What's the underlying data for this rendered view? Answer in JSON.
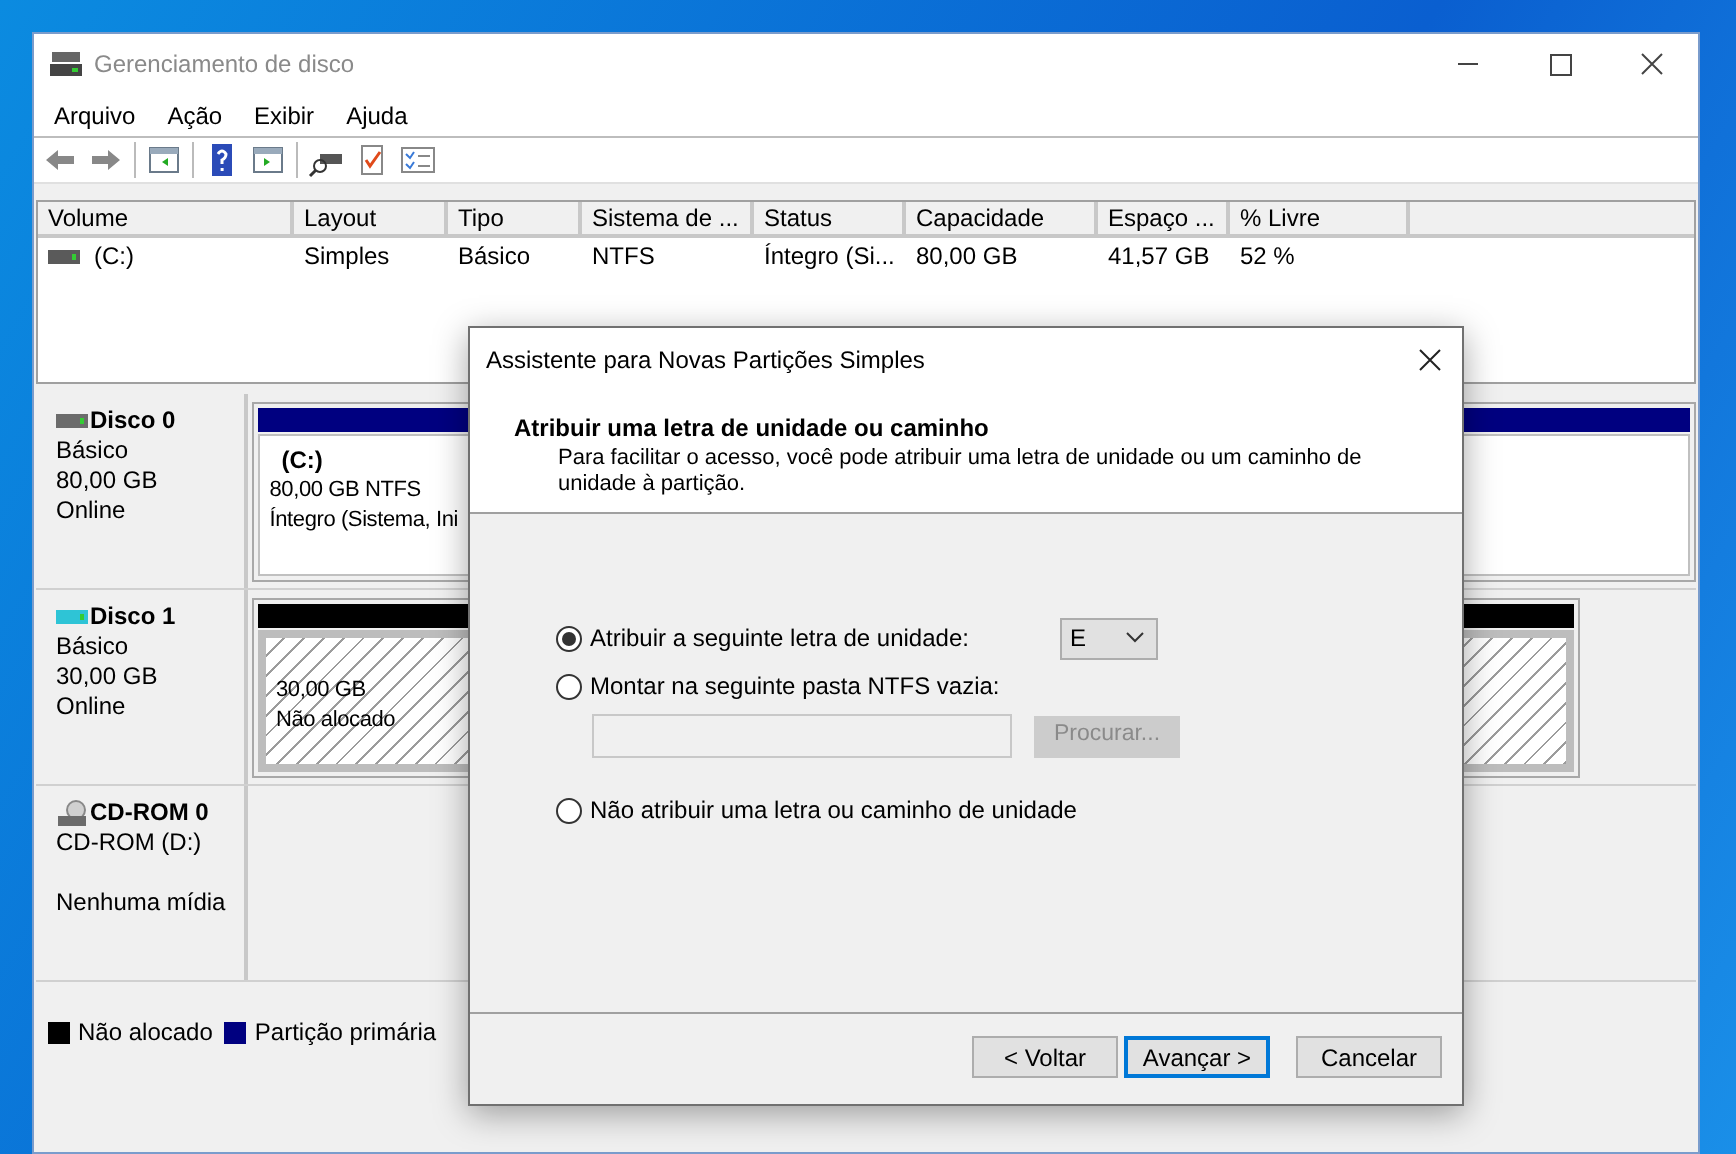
{
  "window": {
    "title": "Gerenciamento de disco"
  },
  "menu": [
    "Arquivo",
    "Ação",
    "Exibir",
    "Ajuda"
  ],
  "table": {
    "columns": [
      "Volume",
      "Layout",
      "Tipo",
      "Sistema de ...",
      "Status",
      "Capacidade",
      "Espaço ...",
      "% Livre"
    ],
    "rows": [
      {
        "cells": [
          "(C:)",
          "Simples",
          "Básico",
          "NTFS",
          "Íntegro (Si...",
          "80,00 GB",
          "41,57 GB",
          "52 %"
        ]
      }
    ]
  },
  "disks": [
    {
      "kind": "disk",
      "color": "#6b6b6b",
      "name": "Disco 0",
      "lines": [
        "Básico",
        "80,00 GB",
        "Online"
      ],
      "partition": {
        "kind": "primary",
        "title": "(C:)",
        "lines": [
          "80,00 GB NTFS",
          "Íntegro (Sistema, Ini"
        ]
      }
    },
    {
      "kind": "disk",
      "color": "#2ec4d6",
      "name": "Disco 1",
      "lines": [
        "Básico",
        "30,00 GB",
        "Online"
      ],
      "partition": {
        "kind": "unallocated",
        "lines": [
          "30,00 GB",
          "Não alocado"
        ]
      }
    },
    {
      "kind": "cdrom",
      "color": "#6b6b6b",
      "name": "CD-ROM 0",
      "lines": [
        "CD-ROM (D:)",
        "Nenhuma mídia"
      ]
    }
  ],
  "legend": [
    {
      "label": "Não alocado",
      "color": "#000000"
    },
    {
      "label": "Partição primária",
      "color": "#000080"
    }
  ],
  "dialog": {
    "title": "Assistente para Novas Partições Simples",
    "heading": "Atribuir uma letra de unidade ou caminho",
    "description": "Para facilitar o acesso, você pode atribuir uma letra de unidade ou um caminho de unidade à partição.",
    "options": [
      {
        "kind": "letter",
        "label": "Atribuir a seguinte letra de unidade:",
        "selected": true
      },
      {
        "kind": "folder",
        "label": "Montar na seguinte pasta NTFS vazia:",
        "selected": false
      },
      {
        "kind": "none",
        "label": "Não atribuir uma letra ou caminho de unidade",
        "selected": false
      }
    ],
    "drive_letter": "E",
    "browse_button": {
      "label": "Procurar...",
      "disabled": true
    },
    "buttons": [
      {
        "label": "< Voltar",
        "default": false
      },
      {
        "label": "Avançar >",
        "default": true
      },
      {
        "label": "Cancelar",
        "default": false
      }
    ]
  }
}
